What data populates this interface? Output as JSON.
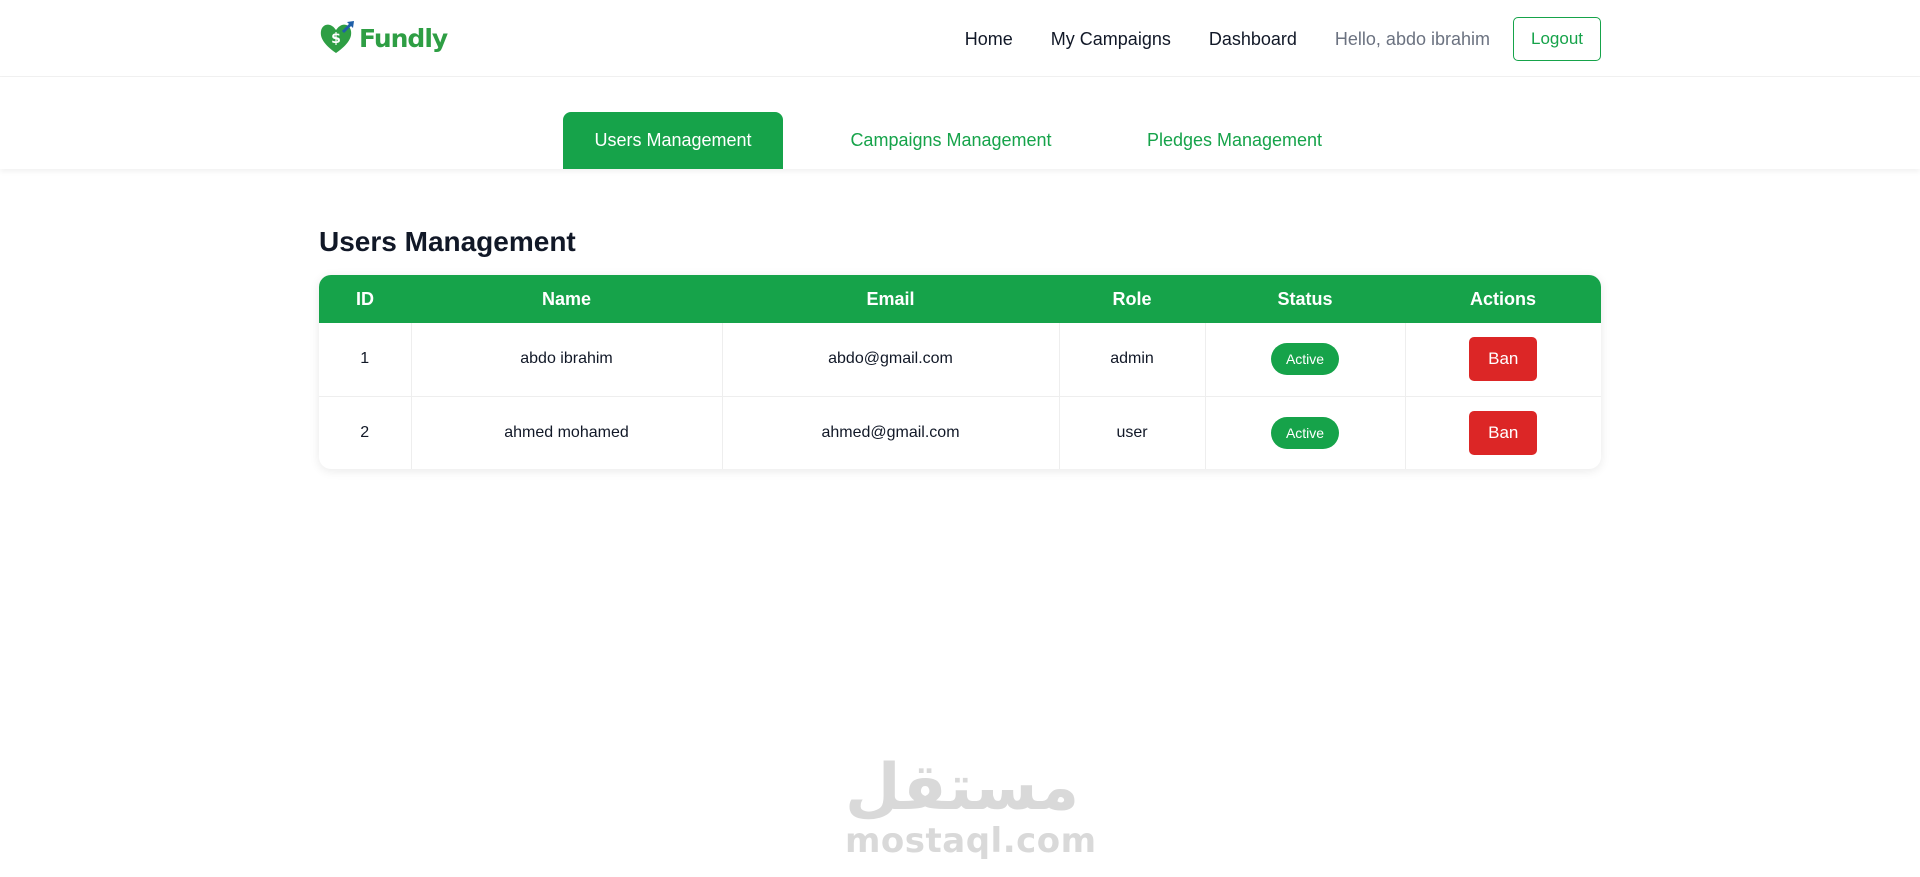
{
  "brand": {
    "name": "Fundly",
    "color": "#16a34a"
  },
  "nav": {
    "links": [
      "Home",
      "My Campaigns",
      "Dashboard"
    ],
    "greeting": "Hello, abdo ibrahim",
    "logout_label": "Logout"
  },
  "tabs": [
    {
      "label": "Users Management",
      "active": true
    },
    {
      "label": "Campaigns Management",
      "active": false
    },
    {
      "label": "Pledges Management",
      "active": false
    }
  ],
  "main": {
    "title": "Users Management"
  },
  "table": {
    "columns": [
      "ID",
      "Name",
      "Email",
      "Role",
      "Status",
      "Actions"
    ],
    "rows": [
      {
        "id": "1",
        "name": "abdo ibrahim",
        "email": "abdo@gmail.com",
        "role": "admin",
        "status": "Active",
        "action": "Ban"
      },
      {
        "id": "2",
        "name": "ahmed mohamed",
        "email": "ahmed@gmail.com",
        "role": "user",
        "status": "Active",
        "action": "Ban"
      }
    ]
  },
  "colors": {
    "accent": "#16a34a",
    "danger": "#dc2626"
  },
  "watermark": {
    "arabic": "مستقل",
    "latin": "mostaql.com"
  }
}
